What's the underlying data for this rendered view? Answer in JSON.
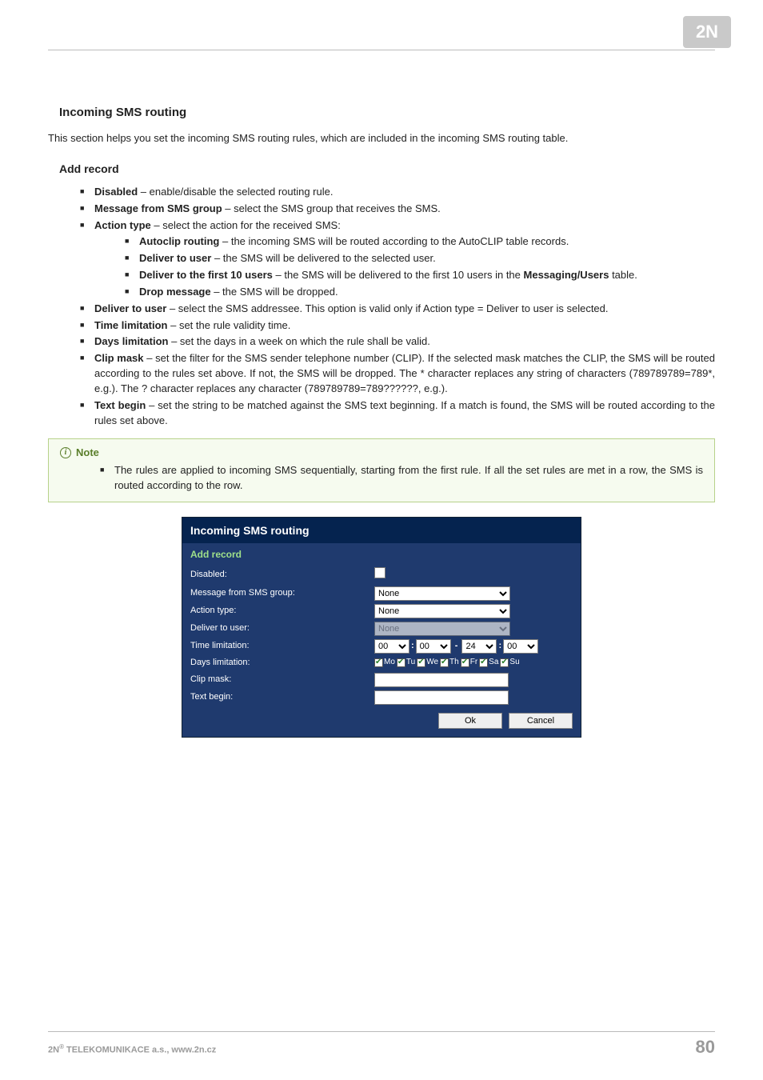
{
  "logo": {
    "text": "2N"
  },
  "sections": {
    "incoming": {
      "heading": "Incoming SMS routing",
      "intro": "This section helps you set the incoming SMS routing rules, which are included in the incoming SMS routing table."
    },
    "add_record": {
      "heading": "Add record",
      "items": [
        {
          "label": "Disabled",
          "text": " – enable/disable the selected routing rule."
        },
        {
          "label": "Message from SMS group",
          "text": " – select the SMS group that receives the SMS."
        },
        {
          "label": "Action type",
          "text": " –  select the action for the received SMS:",
          "children": [
            {
              "label": "Autoclip routing",
              "text": " – the incoming SMS will be routed according to the AutoCLIP table records."
            },
            {
              "label": "Deliver to user",
              "text": " – the SMS will be delivered to the selected user."
            },
            {
              "label": "Deliver to the first 10 users",
              "text": " – the SMS will be delivered to the first 10 users in the  ",
              "label2": "Messaging/Users",
              "text2": " table."
            },
            {
              "label": "Drop message",
              "text": " – the SMS will be dropped."
            }
          ]
        },
        {
          "label": "Deliver to user",
          "text": " – select the SMS addressee. This option is valid only if Action type = Deliver to user is selected."
        },
        {
          "label": "Time limitation",
          "text": " –  set the rule validity time."
        },
        {
          "label": "Days limitation",
          "text": " –  set the days in a week on which the rule shall be valid."
        },
        {
          "label": "Clip mask",
          "text": " – set the filter for the SMS sender telephone number (CLIP). If the selected mask matches the CLIP, the SMS will be routed according to the rules set above. If not, the SMS will be dropped. The * character replaces any string of characters (789789789=789*, e.g.). The ? character replaces any character (789789789=789??????, e.g.)."
        },
        {
          "label": "Text begin",
          "text": " – set the string to be matched against the SMS text beginning. If a match is found, the SMS will be routed according to the rules set above."
        }
      ]
    },
    "note": {
      "title": "Note",
      "text": "The rules are applied to incoming SMS sequentially, starting from the first rule. If all the set rules are met in a row, the SMS is routed according to the row."
    }
  },
  "screenshot": {
    "title": "Incoming SMS routing",
    "subtitle": "Add record",
    "labels": {
      "disabled": "Disabled:",
      "msg_group": "Message from SMS group:",
      "action_type": "Action type:",
      "deliver_user": "Deliver to user:",
      "time_lim": "Time limitation:",
      "days_lim": "Days limitation:",
      "clip_mask": "Clip mask:",
      "text_begin": "Text begin:"
    },
    "values": {
      "msg_group": "None",
      "action_type": "None",
      "deliver_user": "None",
      "time_h1": "00",
      "time_m1": "00",
      "time_h2": "24",
      "time_m2": "00",
      "clip_mask": "",
      "text_begin": ""
    },
    "days": [
      "Mo",
      "Tu",
      "We",
      "Th",
      "Fr",
      "Sa",
      "Su"
    ],
    "buttons": {
      "ok": "Ok",
      "cancel": "Cancel"
    }
  },
  "footer": {
    "left_a": "2N",
    "left_b": "®",
    "left_c": " TELEKOMUNIKACE a.s., www.2n.cz",
    "page": "80"
  }
}
